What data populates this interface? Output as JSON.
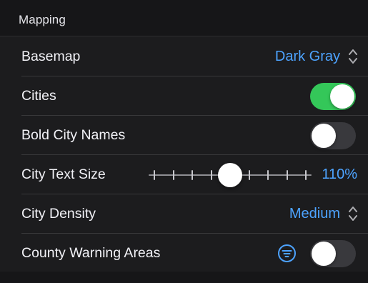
{
  "section": {
    "title": "Mapping"
  },
  "basemap": {
    "label": "Basemap",
    "value": "Dark Gray"
  },
  "cities": {
    "label": "Cities",
    "enabled": true
  },
  "bold_city_names": {
    "label": "Bold City Names",
    "enabled": false
  },
  "city_text_size": {
    "label": "City Text Size",
    "value_label": "110%",
    "slider_level": 0.5
  },
  "city_density": {
    "label": "City Density",
    "value": "Medium"
  },
  "county_warning_areas": {
    "label": "County Warning Areas",
    "enabled": false
  },
  "colors": {
    "accent": "#4da3ff",
    "toggle_on": "#34c759",
    "toggle_off": "#39393d",
    "background": "#1c1c1e"
  },
  "icons": {
    "updown": "chevron-up-down-icon",
    "filter": "filter-circle-icon"
  }
}
